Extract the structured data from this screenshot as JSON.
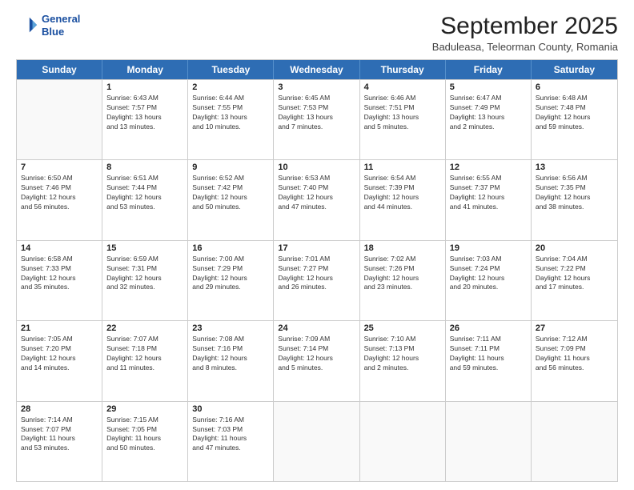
{
  "header": {
    "logo_line1": "General",
    "logo_line2": "Blue",
    "month_title": "September 2025",
    "subtitle": "Baduleasa, Teleorman County, Romania"
  },
  "days_of_week": [
    "Sunday",
    "Monday",
    "Tuesday",
    "Wednesday",
    "Thursday",
    "Friday",
    "Saturday"
  ],
  "rows": [
    [
      {
        "day": "",
        "lines": []
      },
      {
        "day": "1",
        "lines": [
          "Sunrise: 6:43 AM",
          "Sunset: 7:57 PM",
          "Daylight: 13 hours",
          "and 13 minutes."
        ]
      },
      {
        "day": "2",
        "lines": [
          "Sunrise: 6:44 AM",
          "Sunset: 7:55 PM",
          "Daylight: 13 hours",
          "and 10 minutes."
        ]
      },
      {
        "day": "3",
        "lines": [
          "Sunrise: 6:45 AM",
          "Sunset: 7:53 PM",
          "Daylight: 13 hours",
          "and 7 minutes."
        ]
      },
      {
        "day": "4",
        "lines": [
          "Sunrise: 6:46 AM",
          "Sunset: 7:51 PM",
          "Daylight: 13 hours",
          "and 5 minutes."
        ]
      },
      {
        "day": "5",
        "lines": [
          "Sunrise: 6:47 AM",
          "Sunset: 7:49 PM",
          "Daylight: 13 hours",
          "and 2 minutes."
        ]
      },
      {
        "day": "6",
        "lines": [
          "Sunrise: 6:48 AM",
          "Sunset: 7:48 PM",
          "Daylight: 12 hours",
          "and 59 minutes."
        ]
      }
    ],
    [
      {
        "day": "7",
        "lines": [
          "Sunrise: 6:50 AM",
          "Sunset: 7:46 PM",
          "Daylight: 12 hours",
          "and 56 minutes."
        ]
      },
      {
        "day": "8",
        "lines": [
          "Sunrise: 6:51 AM",
          "Sunset: 7:44 PM",
          "Daylight: 12 hours",
          "and 53 minutes."
        ]
      },
      {
        "day": "9",
        "lines": [
          "Sunrise: 6:52 AM",
          "Sunset: 7:42 PM",
          "Daylight: 12 hours",
          "and 50 minutes."
        ]
      },
      {
        "day": "10",
        "lines": [
          "Sunrise: 6:53 AM",
          "Sunset: 7:40 PM",
          "Daylight: 12 hours",
          "and 47 minutes."
        ]
      },
      {
        "day": "11",
        "lines": [
          "Sunrise: 6:54 AM",
          "Sunset: 7:39 PM",
          "Daylight: 12 hours",
          "and 44 minutes."
        ]
      },
      {
        "day": "12",
        "lines": [
          "Sunrise: 6:55 AM",
          "Sunset: 7:37 PM",
          "Daylight: 12 hours",
          "and 41 minutes."
        ]
      },
      {
        "day": "13",
        "lines": [
          "Sunrise: 6:56 AM",
          "Sunset: 7:35 PM",
          "Daylight: 12 hours",
          "and 38 minutes."
        ]
      }
    ],
    [
      {
        "day": "14",
        "lines": [
          "Sunrise: 6:58 AM",
          "Sunset: 7:33 PM",
          "Daylight: 12 hours",
          "and 35 minutes."
        ]
      },
      {
        "day": "15",
        "lines": [
          "Sunrise: 6:59 AM",
          "Sunset: 7:31 PM",
          "Daylight: 12 hours",
          "and 32 minutes."
        ]
      },
      {
        "day": "16",
        "lines": [
          "Sunrise: 7:00 AM",
          "Sunset: 7:29 PM",
          "Daylight: 12 hours",
          "and 29 minutes."
        ]
      },
      {
        "day": "17",
        "lines": [
          "Sunrise: 7:01 AM",
          "Sunset: 7:27 PM",
          "Daylight: 12 hours",
          "and 26 minutes."
        ]
      },
      {
        "day": "18",
        "lines": [
          "Sunrise: 7:02 AM",
          "Sunset: 7:26 PM",
          "Daylight: 12 hours",
          "and 23 minutes."
        ]
      },
      {
        "day": "19",
        "lines": [
          "Sunrise: 7:03 AM",
          "Sunset: 7:24 PM",
          "Daylight: 12 hours",
          "and 20 minutes."
        ]
      },
      {
        "day": "20",
        "lines": [
          "Sunrise: 7:04 AM",
          "Sunset: 7:22 PM",
          "Daylight: 12 hours",
          "and 17 minutes."
        ]
      }
    ],
    [
      {
        "day": "21",
        "lines": [
          "Sunrise: 7:05 AM",
          "Sunset: 7:20 PM",
          "Daylight: 12 hours",
          "and 14 minutes."
        ]
      },
      {
        "day": "22",
        "lines": [
          "Sunrise: 7:07 AM",
          "Sunset: 7:18 PM",
          "Daylight: 12 hours",
          "and 11 minutes."
        ]
      },
      {
        "day": "23",
        "lines": [
          "Sunrise: 7:08 AM",
          "Sunset: 7:16 PM",
          "Daylight: 12 hours",
          "and 8 minutes."
        ]
      },
      {
        "day": "24",
        "lines": [
          "Sunrise: 7:09 AM",
          "Sunset: 7:14 PM",
          "Daylight: 12 hours",
          "and 5 minutes."
        ]
      },
      {
        "day": "25",
        "lines": [
          "Sunrise: 7:10 AM",
          "Sunset: 7:13 PM",
          "Daylight: 12 hours",
          "and 2 minutes."
        ]
      },
      {
        "day": "26",
        "lines": [
          "Sunrise: 7:11 AM",
          "Sunset: 7:11 PM",
          "Daylight: 11 hours",
          "and 59 minutes."
        ]
      },
      {
        "day": "27",
        "lines": [
          "Sunrise: 7:12 AM",
          "Sunset: 7:09 PM",
          "Daylight: 11 hours",
          "and 56 minutes."
        ]
      }
    ],
    [
      {
        "day": "28",
        "lines": [
          "Sunrise: 7:14 AM",
          "Sunset: 7:07 PM",
          "Daylight: 11 hours",
          "and 53 minutes."
        ]
      },
      {
        "day": "29",
        "lines": [
          "Sunrise: 7:15 AM",
          "Sunset: 7:05 PM",
          "Daylight: 11 hours",
          "and 50 minutes."
        ]
      },
      {
        "day": "30",
        "lines": [
          "Sunrise: 7:16 AM",
          "Sunset: 7:03 PM",
          "Daylight: 11 hours",
          "and 47 minutes."
        ]
      },
      {
        "day": "",
        "lines": []
      },
      {
        "day": "",
        "lines": []
      },
      {
        "day": "",
        "lines": []
      },
      {
        "day": "",
        "lines": []
      }
    ]
  ]
}
